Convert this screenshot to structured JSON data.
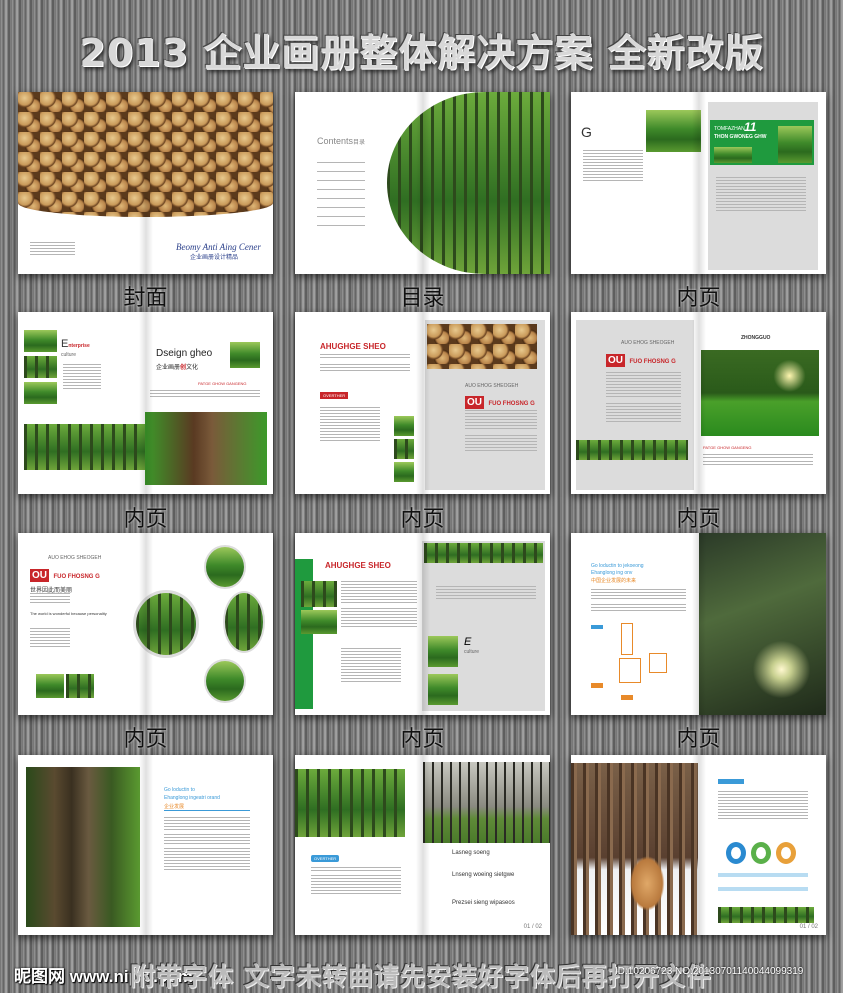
{
  "header": {
    "title": "2013 企业画册整体解决方案  全新改版"
  },
  "labels": [
    "封面",
    "目录",
    "内页",
    "内页",
    "内页",
    "内页",
    "内页",
    "内页",
    "内页"
  ],
  "spreads": {
    "cover": {
      "brand": "Beomy Anti Aing Cener",
      "brand_cn": "企业画册设计精品"
    },
    "contents": {
      "title": "Contents",
      "title_cn": "目录"
    },
    "s3": {
      "g": "G",
      "banner_a": "TOMFAZHAN",
      "banner_num": "11",
      "banner_b": "THON GWONEG GHW"
    },
    "s4": {
      "e": "E",
      "e_sub": "nterprise",
      "culture": "culture",
      "design": "Dseign gheo",
      "design_cn": "企业画册",
      "design_cn2": "创",
      "design_cn3": "文化",
      "tag": "PATGE GHOW GANGENG"
    },
    "s5": {
      "head": "AHUGHGE SHEO",
      "over": "OVERTHER",
      "sub": "AUO EHOG SHEOGEH",
      "ou": "OU",
      "fuo": "FUO FHOSNG G"
    },
    "s6": {
      "sub": "AUO EHOG SHEOGEH",
      "ou": "OU",
      "fuo": "FUO FHOSNG G",
      "zhong": "ZHONGGUO",
      "tag": "PATGE GHOW GANGENG"
    },
    "s7": {
      "sub": "AUO EHOG SHEOGEH",
      "ou": "OU",
      "fuo": "FUO FHOSNG G",
      "cn": "世界因此而美丽",
      "en": "The world is wonderful because personality"
    },
    "s8": {
      "head": "AHUGHGE SHEO",
      "e": "E",
      "culture": "culture"
    },
    "s9": {
      "l1": "Go loductin to jekoeong",
      "l2": "Ehanglong ing onv",
      "l3": "中国企业发展的未来"
    },
    "s10": {
      "l1": "Go loductin to",
      "l2": "Ehanglong ingeatri orand",
      "l3": "企业发展"
    },
    "s11": {
      "over": "OVERTHER",
      "h1": "Lasneg soeng",
      "h2": "Lnseng woeing sietgwe",
      "h3": "Prezsei sieng wipaseos",
      "page": "01 / 02"
    },
    "s12": {
      "page": "01 / 02"
    }
  },
  "footer": {
    "notice": "附带字体 文字未转曲请先安装好字体后再打开文件",
    "watermark": "昵图网 www.nipic.com",
    "id": "ID:10206723 NO:20130701140044099319"
  },
  "colors": {
    "accent_red": "#c8262a",
    "accent_green": "#1f9a3e",
    "accent_blue": "#3a9ad8"
  }
}
